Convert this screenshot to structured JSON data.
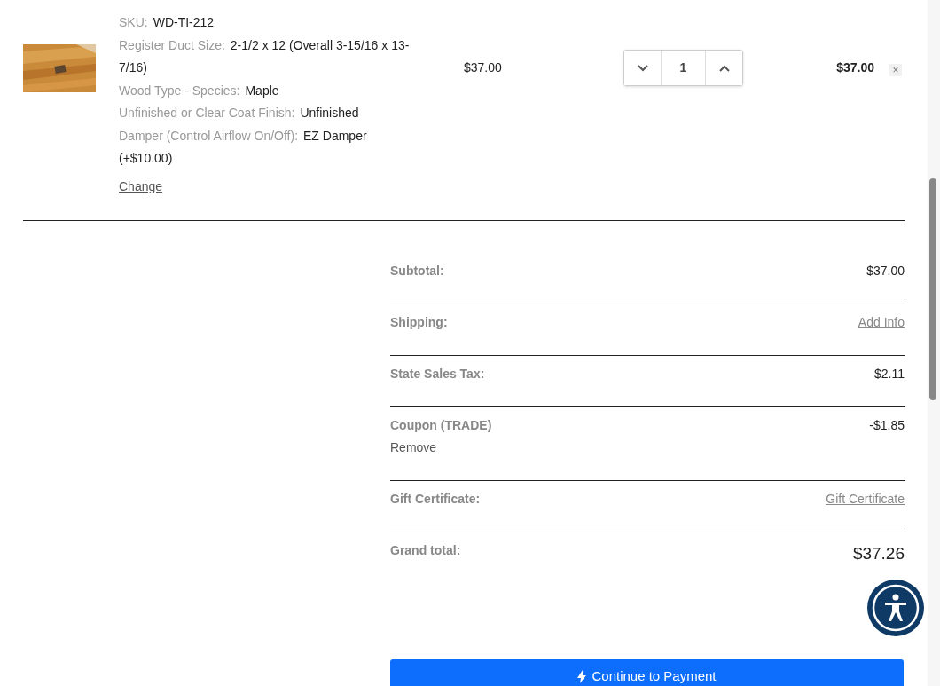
{
  "product": {
    "options": [
      {
        "label": "SKU:",
        "value": "WD-TI-212"
      },
      {
        "label": "Register Duct Size:",
        "value": "2-1/2 x 12 (Overall 3-15/16 x 13-7/16)"
      },
      {
        "label": "Wood Type - Species:",
        "value": "Maple"
      },
      {
        "label": "Unfinished or Clear Coat Finish:",
        "value": "Unfinished"
      },
      {
        "label": "Damper (Control Airflow On/Off):",
        "value": "EZ Damper (+$10.00)"
      }
    ],
    "change_link": "Change",
    "price": "$37.00",
    "quantity": "1",
    "total": "$37.00",
    "remove": "×"
  },
  "summary": {
    "rows": [
      {
        "kind": "value",
        "label": "Subtotal:",
        "value": "$37.00"
      },
      {
        "kind": "link",
        "label": "Shipping:",
        "value": "Add Info"
      },
      {
        "kind": "value",
        "label": "State Sales Tax:",
        "value": "$2.11"
      },
      {
        "kind": "coupon",
        "label": "Coupon (TRADE)",
        "value": "-$1.85",
        "action": "Remove"
      },
      {
        "kind": "link",
        "label": "Gift Certificate:",
        "value": "Gift Certificate"
      },
      {
        "kind": "grand",
        "label": "Grand total:",
        "value": "$37.26"
      }
    ]
  },
  "checkout_button": "Continue to Payment"
}
